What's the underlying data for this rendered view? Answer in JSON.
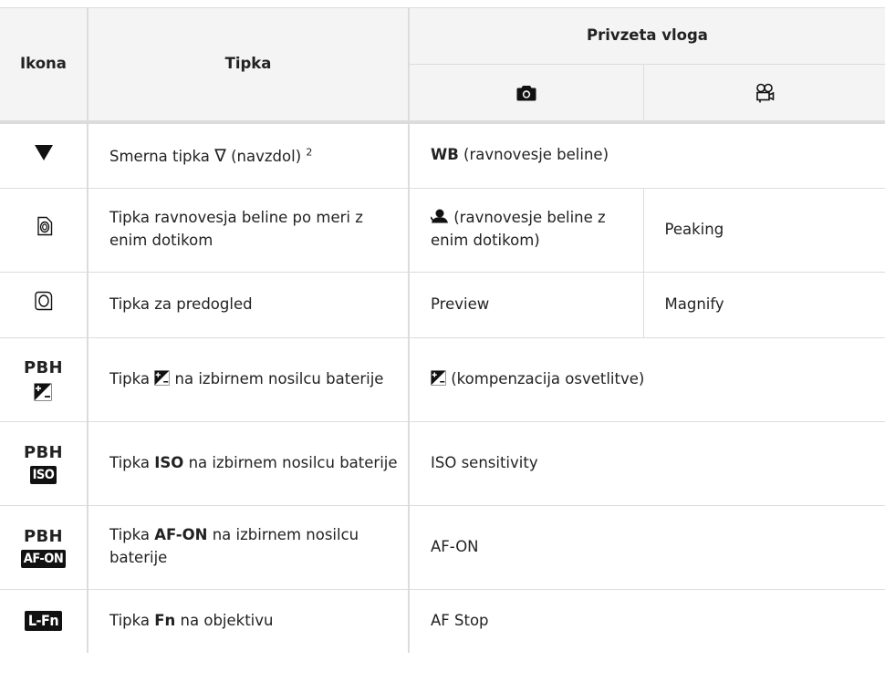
{
  "table": {
    "headers": {
      "icon": "Ikona",
      "button": "Tipka",
      "function": "Privzeta vloga"
    },
    "rows": [
      {
        "icon_name": "down-triangle-icon",
        "button_pre": "Smerna tipka ",
        "button_glyph": "∇",
        "button_post": " (navzdol) ",
        "button_sup": "2",
        "photo_bold": "WB",
        "photo_rest": " (ravnovesje beline)",
        "span": true
      },
      {
        "icon_name": "one-touch-wb-button-icon",
        "button": "Tipka ravnovesja beline po meri z enim dotikom",
        "photo_rest": " (ravnovesje beline z enim dotikom)",
        "movie": "Peaking",
        "span": false
      },
      {
        "icon_name": "preview-button-icon",
        "button": "Tipka za predogled",
        "photo": "Preview",
        "movie": "Magnify",
        "span": false
      },
      {
        "icon_label": "PBH",
        "icon_name": "exposure-compensation-icon",
        "button_pre": "Tipka ",
        "button_post": " na izbirnem nosilcu baterije",
        "photo_rest": " (kompenzacija osvetlitve)",
        "span": true
      },
      {
        "icon_label": "PBH",
        "icon_badge": "ISO",
        "button_pre": "Tipka ",
        "button_bold": "ISO",
        "button_post": " na izbirnem nosilcu baterije",
        "photo": "ISO sensitivity",
        "span": true
      },
      {
        "icon_label": "PBH",
        "icon_badge": "AF-ON",
        "button_pre": "Tipka ",
        "button_bold": "AF-ON",
        "button_post": " na izbirnem nosilcu baterije",
        "photo": "AF-ON",
        "span": true
      },
      {
        "icon_badge": "L-Fn",
        "button_pre": "Tipka ",
        "button_bold": "Fn",
        "button_post": " na objektivu",
        "photo": "AF Stop",
        "span": true
      }
    ]
  }
}
